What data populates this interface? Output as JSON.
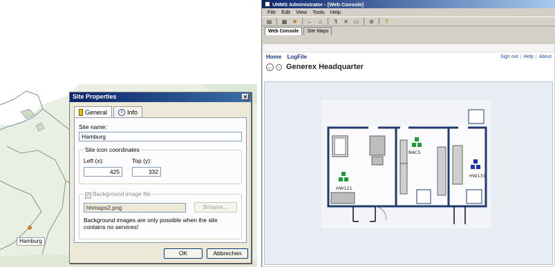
{
  "site_dialog": {
    "title": "Site Properties",
    "close_glyph": "×",
    "tabs": [
      {
        "label": "General",
        "icon": "yellow-marker-icon",
        "active": true
      },
      {
        "label": "Info",
        "icon": "info-icon",
        "active": false
      }
    ],
    "site_name_label": "Site name:",
    "site_name_value": "Hamburg",
    "coords_group_title": "Site icon coordinates",
    "left_label": "Left (x):",
    "left_value": "425",
    "top_label": "Top (y):",
    "top_value": "332",
    "bg_group_title": "Background image file",
    "bg_file_value": "hhmaps2.png",
    "browse_label": "Browse...",
    "bg_note": "Background images are only possible when the site contains no services!",
    "ok_label": "OK",
    "cancel_label": "Abbrechen"
  },
  "map": {
    "city_label": "Hamburg",
    "city_dot_color": "#e08a28"
  },
  "console": {
    "window_title": "UNMS Administrator - [Web Console]",
    "menu": [
      "File",
      "Edit",
      "View",
      "Tools",
      "Help"
    ],
    "tabs": [
      {
        "label": "Web Console",
        "active": true
      },
      {
        "label": "Site Maps",
        "active": false
      }
    ],
    "nav": {
      "home": "Home",
      "logfile": "LogFile"
    },
    "user_links": {
      "sign_out": "Sign out",
      "help": "Help",
      "about": "About",
      "separator": "|"
    },
    "page_heading": "Generex Headquarter",
    "floorplan": {
      "devices": [
        {
          "label": "HW121",
          "status": "ok",
          "color": "#1e9e2e"
        },
        {
          "label": "BACS",
          "status": "ok",
          "color": "#1e9e2e"
        },
        {
          "label": "HW131",
          "status": "info",
          "color": "#1b2fa8"
        }
      ]
    }
  }
}
